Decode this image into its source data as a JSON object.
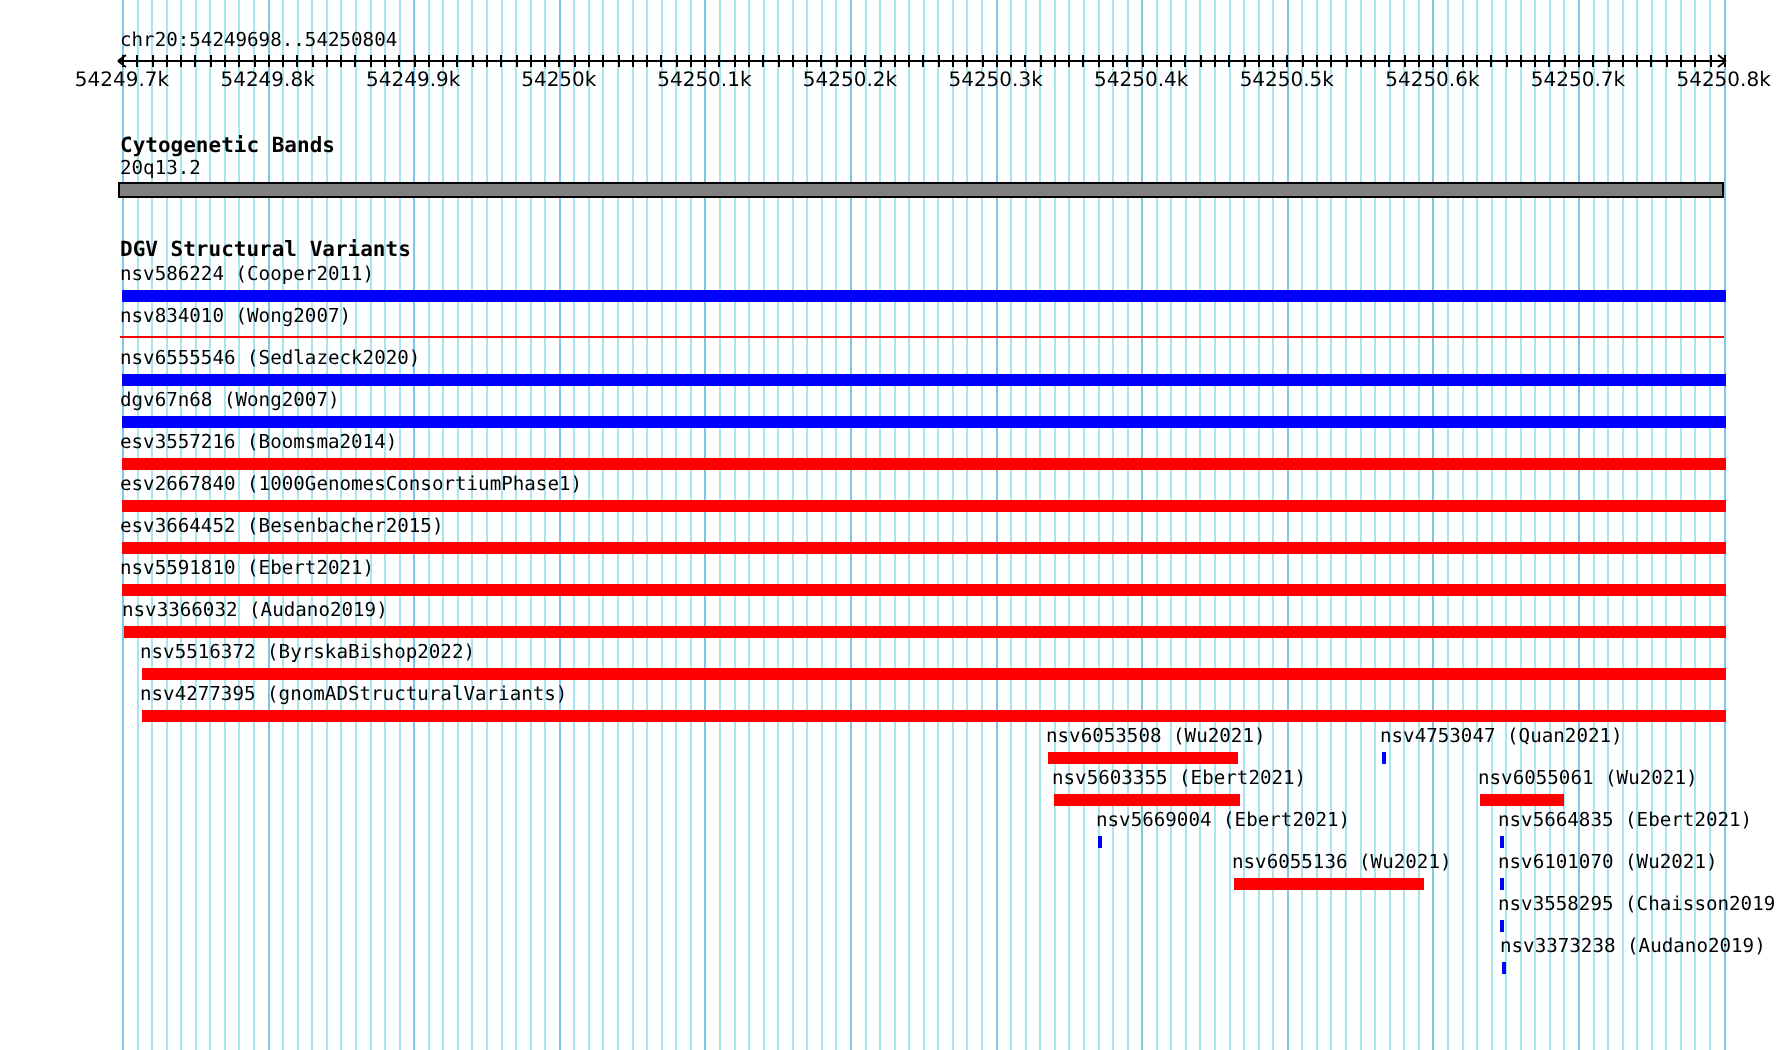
{
  "locus": "chr20:54249698..54250804",
  "ruler": {
    "ticks": [
      "54249.7k",
      "54249.8k",
      "54249.9k",
      "54250k",
      "54250.1k",
      "54250.2k",
      "54250.3k",
      "54250.4k",
      "54250.5k",
      "54250.6k",
      "54250.7k",
      "54250.8k"
    ]
  },
  "cytogenetic_track": {
    "title": "Cytogenetic Bands",
    "band": "20q13.2"
  },
  "variant_track": {
    "title": "DGV Structural Variants",
    "features": [
      {
        "label": "nsv586224 (Cooper2011)",
        "color": "#0000ff",
        "kind": "bar"
      },
      {
        "label": "nsv834010 (Wong2007)",
        "color": "#ff0000",
        "kind": "line"
      },
      {
        "label": "nsv6555546 (Sedlazeck2020)",
        "color": "#0000ff",
        "kind": "bar"
      },
      {
        "label": "dgv67n68 (Wong2007)",
        "color": "#0000ff",
        "kind": "bar"
      },
      {
        "label": "esv3557216 (Boomsma2014)",
        "color": "#ff0000",
        "kind": "bar"
      },
      {
        "label": "esv2667840 (1000GenomesConsortiumPhase1)",
        "color": "#ff0000",
        "kind": "bar"
      },
      {
        "label": "esv3664452 (Besenbacher2015)",
        "color": "#ff0000",
        "kind": "bar"
      },
      {
        "label": "nsv5591810 (Ebert2021)",
        "color": "#ff0000",
        "kind": "bar"
      },
      {
        "label": "nsv3366032 (Audano2019)",
        "color": "#ff0000",
        "kind": "bar"
      },
      {
        "label": "nsv5516372 (ByrskaBishop2022)",
        "color": "#ff0000",
        "kind": "bar"
      },
      {
        "label": "nsv4277395 (gnomADStructuralVariants)",
        "color": "#ff0000",
        "kind": "bar"
      },
      {
        "label": "nsv6053508 (Wu2021)",
        "color": "#ff0000",
        "kind": "bar"
      },
      {
        "label": "nsv4753047 (Quan2021)",
        "color": "#0000ff",
        "kind": "bar"
      },
      {
        "label": "nsv5603355 (Ebert2021)",
        "color": "#ff0000",
        "kind": "bar"
      },
      {
        "label": "nsv6055061 (Wu2021)",
        "color": "#ff0000",
        "kind": "bar"
      },
      {
        "label": "nsv5669004 (Ebert2021)",
        "color": "#0000ff",
        "kind": "bar"
      },
      {
        "label": "nsv5664835 (Ebert2021)",
        "color": "#0000ff",
        "kind": "bar"
      },
      {
        "label": "nsv6055136 (Wu2021)",
        "color": "#ff0000",
        "kind": "bar"
      },
      {
        "label": "nsv6101070 (Wu2021)",
        "color": "#0000ff",
        "kind": "bar"
      },
      {
        "label": "nsv3558295 (Chaisson2019",
        "color": "#0000ff",
        "kind": "bar"
      },
      {
        "label": "nsv3373238 (Audano2019)",
        "color": "#0000ff",
        "kind": "bar"
      }
    ]
  }
}
